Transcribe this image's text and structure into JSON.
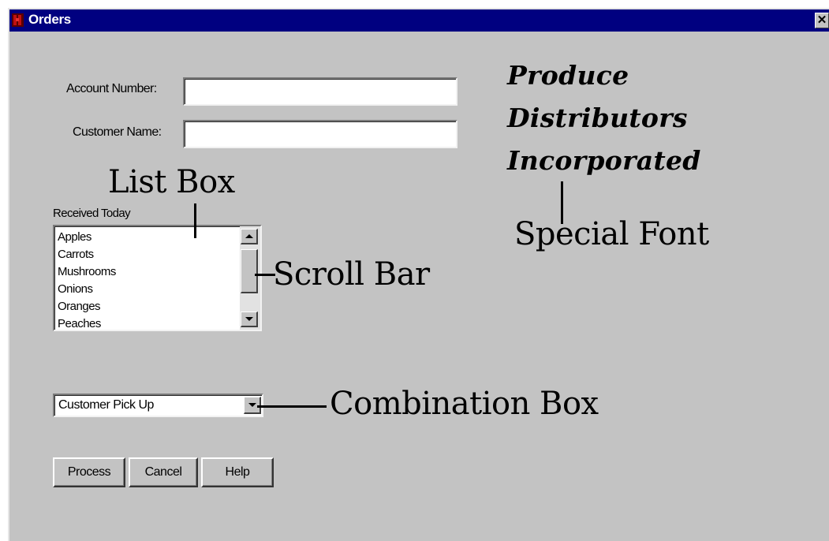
{
  "window": {
    "title": "Orders",
    "close_glyph": "✕"
  },
  "form": {
    "account_label": "Account Number:",
    "account_value": "",
    "customer_label": "Customer Name:",
    "customer_value": "",
    "list_heading": "Received Today",
    "list_items": [
      "Apples",
      "Carrots",
      "Mushrooms",
      "Onions",
      "Oranges",
      "Peaches"
    ],
    "delivery_selected": "Customer Pick Up",
    "buttons": {
      "process": "Process",
      "cancel": "Cancel",
      "help": "Help"
    }
  },
  "branding": {
    "line1": "Produce",
    "line2": "Distributors",
    "line3": "Incorporated"
  },
  "annotations": {
    "list_box": "List Box",
    "scroll_bar": "Scroll Bar",
    "special_font": "Special Font",
    "combination_box": "Combination Box"
  },
  "icons": {
    "app": "app-icon",
    "close": "close-icon",
    "scroll_up": "scroll-up-arrow-icon",
    "scroll_down": "scroll-down-arrow-icon",
    "combo_dropdown": "dropdown-arrow-icon"
  },
  "colors": {
    "titlebar": "#000080",
    "window_face": "#c3c3c3",
    "field_background": "#ffffff"
  }
}
